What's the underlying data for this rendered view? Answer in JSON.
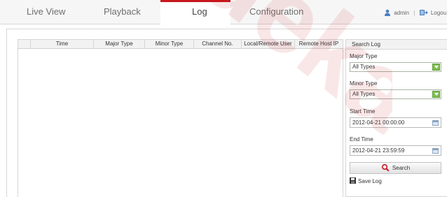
{
  "nav": {
    "tabs": [
      {
        "label": "Live View",
        "active": false
      },
      {
        "label": "Playback",
        "active": false
      },
      {
        "label": "Log",
        "active": true
      },
      {
        "label": "Configuration",
        "active": false
      }
    ],
    "user_icon": "user-icon",
    "username": "admin",
    "separator": "|",
    "logout_icon": "logout-icon",
    "logout_label": "Logou"
  },
  "log_table": {
    "columns": [
      "Time",
      "Major Type",
      "Minor Type",
      "Channel No.",
      "Local/Remote User",
      "Remote Host IP"
    ],
    "rows": []
  },
  "search_panel": {
    "title": "Search Log",
    "major_type": {
      "label": "Major Type",
      "value": "All Types"
    },
    "minor_type": {
      "label": "Minor Type",
      "value": "All Types"
    },
    "start_time": {
      "label": "Start Time",
      "value": "2012-04-21 00:00:00"
    },
    "end_time": {
      "label": "End Time",
      "value": "2012-04-21 23:59:59"
    },
    "search_button": {
      "label": "Search",
      "icon": "search-icon"
    },
    "save_log": {
      "label": "Save Log",
      "icon": "save-icon"
    }
  },
  "colors": {
    "active_tab_accent": "#c8171d",
    "select_arrow": "#7fbf50",
    "search_icon": "#c8171d",
    "watermark": "#c8171d"
  },
  "watermark_text": "Jideka"
}
